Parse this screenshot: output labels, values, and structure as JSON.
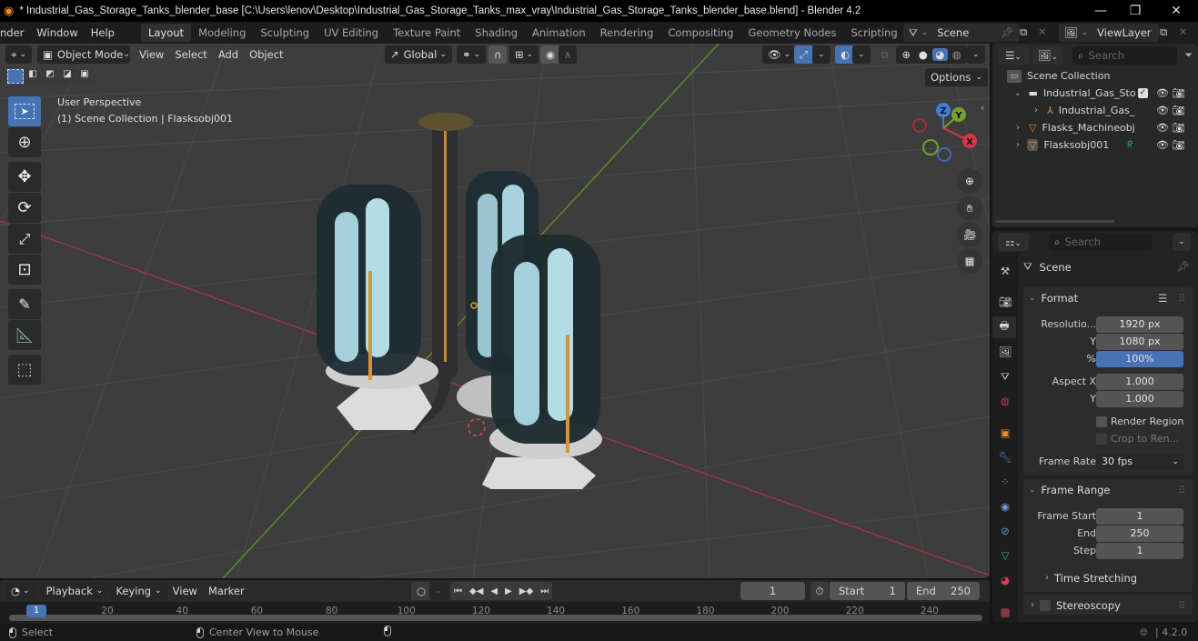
{
  "window": {
    "title": "* Industrial_Gas_Storage_Tanks_blender_base [C:\\Users\\lenov\\Desktop\\Industrial_Gas_Storage_Tanks_max_vray\\Industrial_Gas_Storage_Tanks_blender_base.blend] - Blender 4.2",
    "controls": {
      "minimize": "—",
      "maximize": "❐",
      "close": "✕"
    }
  },
  "menu": {
    "items": [
      "nder",
      "Window",
      "Help"
    ],
    "workspaces": [
      "Layout",
      "Modeling",
      "Sculpting",
      "UV Editing",
      "Texture Paint",
      "Shading",
      "Animation",
      "Rendering",
      "Compositing",
      "Geometry Nodes",
      "Scripting"
    ],
    "active_workspace": "Layout",
    "add_workspace": "+",
    "scene_name": "Scene",
    "view_layer": "ViewLayer"
  },
  "viewport": {
    "mode": "Object Mode",
    "menus": [
      "View",
      "Select",
      "Add",
      "Object"
    ],
    "transform_orientation": "Global",
    "options_label": "Options",
    "overlay_text_1": "User Perspective",
    "overlay_text_2": "(1) Scene Collection | Flasksobj001",
    "gizmo_axes": {
      "x": "X",
      "y": "Y",
      "z": "Z"
    },
    "tools": [
      "select-box",
      "cursor",
      "move",
      "rotate",
      "scale",
      "transform",
      "annotate",
      "measure",
      "add-cube"
    ]
  },
  "outliner": {
    "search_placeholder": "Search",
    "root": "Scene Collection",
    "rows": [
      {
        "label": "Industrial_Gas_Sto",
        "type": "collection",
        "indent": 1,
        "checked": true
      },
      {
        "label": "Industrial_Gas_",
        "type": "empty",
        "indent": 2
      },
      {
        "label": "Flasks_Machineobj",
        "type": "mesh",
        "indent": 1
      },
      {
        "label": "Flasksobj001",
        "type": "mesh",
        "indent": 1,
        "selected": true
      }
    ]
  },
  "properties": {
    "search_placeholder": "Search",
    "context": "Scene",
    "format": {
      "title": "Format",
      "res_x_label": "Resolutio...",
      "res_x": "1920 px",
      "res_y_label": "Y",
      "res_y": "1080 px",
      "percent_label": "%",
      "percent": "100%",
      "aspect_x_label": "Aspect X",
      "aspect_x": "1.000",
      "aspect_y_label": "Y",
      "aspect_y": "1.000",
      "render_region": "Render Region",
      "crop": "Crop to Ren...",
      "frame_rate_label": "Frame Rate",
      "frame_rate": "30 fps"
    },
    "frame_range": {
      "title": "Frame Range",
      "start_label": "Frame Start",
      "start": "1",
      "end_label": "End",
      "end": "250",
      "step_label": "Step",
      "step": "1",
      "time_stretching": "Time Stretching"
    },
    "stereoscopy": "Stereoscopy"
  },
  "timeline": {
    "menus": [
      "Playback",
      "Keying",
      "View",
      "Marker"
    ],
    "current_frame": "1",
    "start_label": "Start",
    "start": "1",
    "end_label": "End",
    "end": "250",
    "ticks": [
      "20",
      "40",
      "60",
      "80",
      "100",
      "120",
      "140",
      "160",
      "180",
      "200",
      "220",
      "240"
    ],
    "playhead": "1"
  },
  "statusbar": {
    "select": "Select",
    "center_view": "Center View to Mouse",
    "version": "4.2.0"
  },
  "colors": {
    "accent": "#4772b3",
    "x_axis": "#d4374a",
    "y_axis": "#76a032",
    "z_axis": "#3d7fd8"
  }
}
